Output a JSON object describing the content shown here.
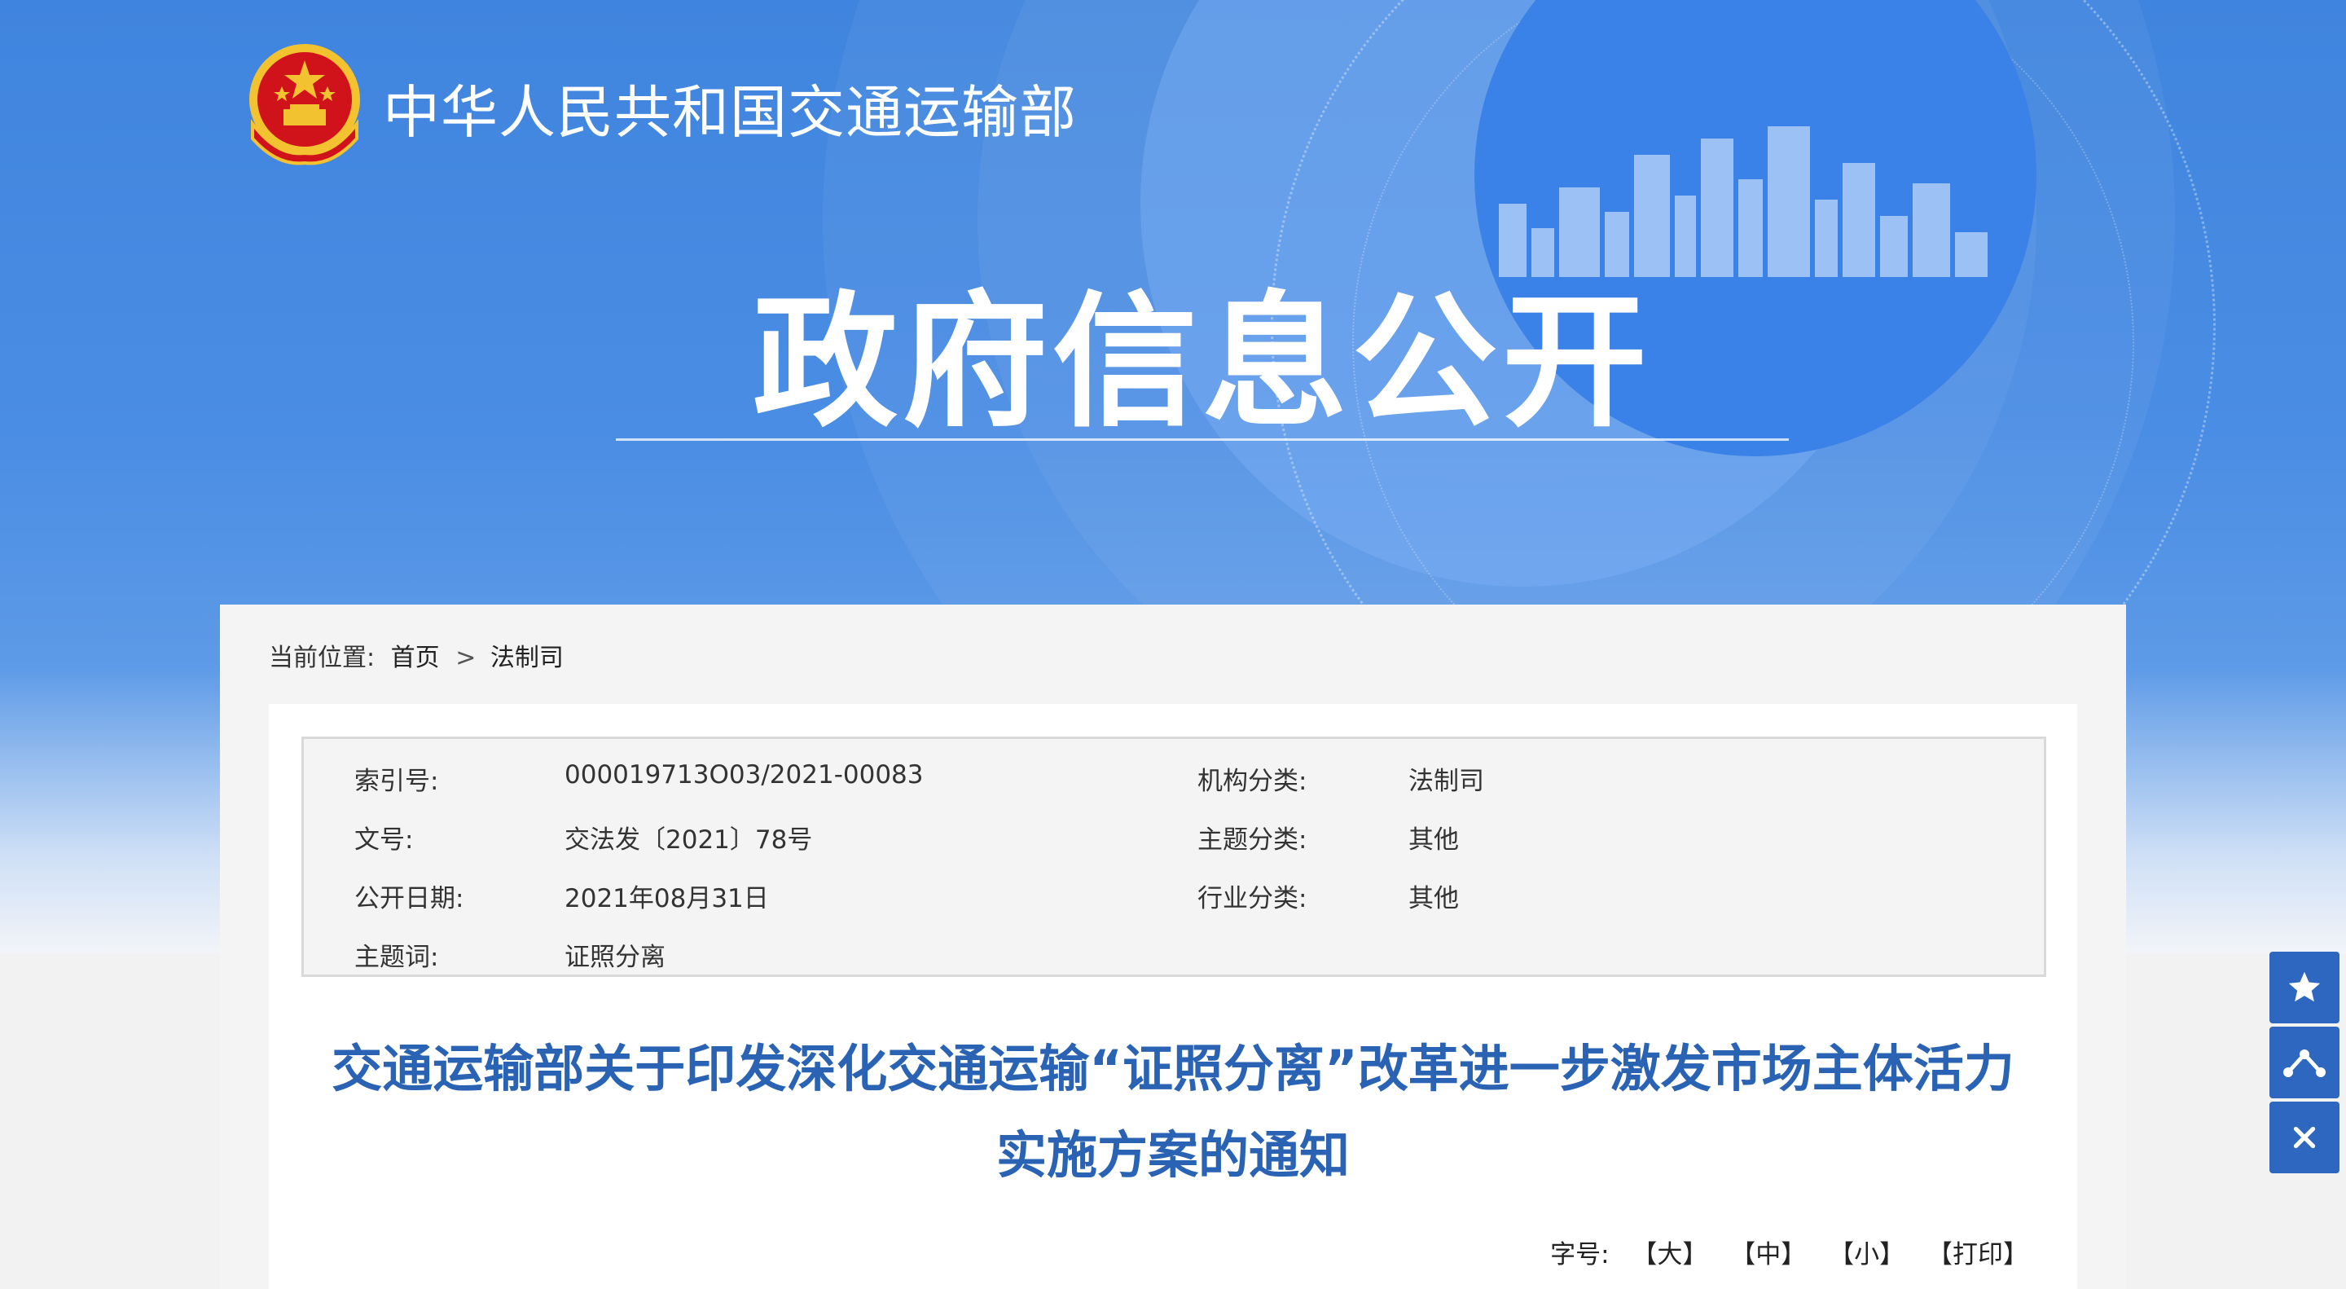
{
  "header": {
    "site_title": "中华人民共和国交通运输部",
    "section_title": "政府信息公开"
  },
  "breadcrumb": {
    "label": "当前位置:",
    "items": [
      "首页",
      "法制司"
    ],
    "separator": ">"
  },
  "meta": {
    "index_no": {
      "label": "索引号:",
      "value": "000019713O03/2021-00083"
    },
    "org_category": {
      "label": "机构分类:",
      "value": "法制司"
    },
    "doc_no": {
      "label": "文号:",
      "value": "交法发〔2021〕78号"
    },
    "topic_category": {
      "label": "主题分类:",
      "value": "其他"
    },
    "publish_date": {
      "label": "公开日期:",
      "value": "2021年08月31日"
    },
    "industry_category": {
      "label": "行业分类:",
      "value": "其他"
    },
    "keywords": {
      "label": "主题词:",
      "value": "证照分离"
    }
  },
  "document": {
    "title_line1": "交通运输部关于印发深化交通运输“证照分离”改革进一步激发市场主体活力",
    "title_line2": "实施方案的通知"
  },
  "font_controls": {
    "label": "字号:",
    "large": "【大】",
    "medium": "【中】",
    "small": "【小】",
    "print": "【打印】"
  },
  "float_bar": {
    "icons": [
      "star-icon",
      "share-icon",
      "close-icon"
    ]
  },
  "colors": {
    "banner_blue": "#3f84de",
    "title_blue": "#2a63b3",
    "float_button": "#2d67c0",
    "emblem_red": "#d0121b",
    "emblem_gold": "#f2c230"
  }
}
